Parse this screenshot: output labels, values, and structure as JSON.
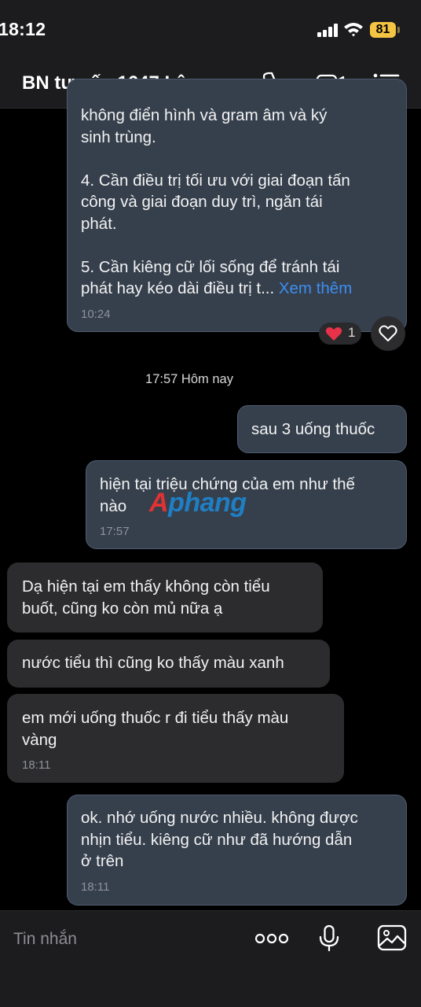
{
  "status_bar": {
    "time": "18:12",
    "battery": "81"
  },
  "header": {
    "title": "BN tư vấn 1647 Lậu..."
  },
  "icons": {
    "call": "phone-icon",
    "video": "video-call-icon",
    "menu": "list-menu-icon",
    "more": "more-dots-icon",
    "mic": "microphone-icon",
    "gallery": "image-gallery-icon"
  },
  "messages": [
    {
      "sender": "me",
      "text": "không điển hình và gram âm và ký\nsinh trùng.\n\n4. Cần điều trị tối ưu với giai đoạn tấn\ncông và giai đoạn duy trì, ngăn tái\nphát.\n\n5. Cần kiêng cữ lối sống để tránh tái\nphát hay kéo dài điều trị t... ",
      "more": "Xem thêm",
      "time": "10:24"
    },
    {
      "sender": "me",
      "text": "sau 3 uống thuốc"
    },
    {
      "sender": "me",
      "text": "hiện tại triệu chứng của em như thế\nnào",
      "time": "17:57"
    },
    {
      "sender": "them",
      "text": "Dạ hiện tại em thấy không còn tiểu\nbuốt, cũng ko còn mủ nữa ạ"
    },
    {
      "sender": "them",
      "text": "nước tiểu thì cũng ko thấy màu xanh"
    },
    {
      "sender": "them",
      "text": "em mới uống thuốc r đi tiểu thấy màu\nvàng",
      "time": "18:11"
    },
    {
      "sender": "me",
      "text": "ok. nhớ uống nước nhiều. không được\nnhịn tiểu. kiêng cữ như đã hướng dẫn\nở trên",
      "time": "18:11"
    }
  ],
  "reaction": {
    "count": "1"
  },
  "date_divider": "17:57 Hôm nay",
  "watermark": {
    "first": "A",
    "rest": "phang"
  },
  "composer": {
    "placeholder": "Tin nhắn"
  },
  "colors": {
    "background": "#000000",
    "bar_background": "#1c1c1e",
    "my_bubble": "#36404d",
    "their_bubble": "#2c2c2e",
    "link": "#3d8ef0",
    "battery": "#f4c542"
  }
}
